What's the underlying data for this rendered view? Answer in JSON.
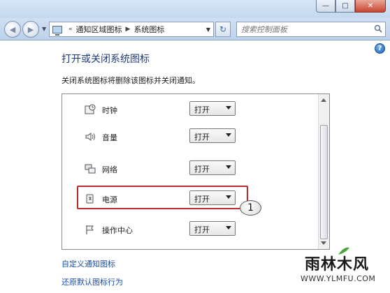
{
  "window": {
    "minimize_label": "—",
    "maximize_label": "□",
    "close_label": "✕"
  },
  "addressbar": {
    "crumbs": [
      "通知区域图标",
      "系统图标"
    ],
    "search_placeholder": "搜索控制面板"
  },
  "main": {
    "title": "打开或关闭系统图标",
    "description": "关闭系统图标将删除该图标并关闭通知。",
    "items": [
      {
        "name": "时钟",
        "value": "打开",
        "icon": "clock-icon"
      },
      {
        "name": "音量",
        "value": "打开",
        "icon": "volume-icon"
      },
      {
        "name": "网络",
        "value": "打开",
        "icon": "network-icon"
      },
      {
        "name": "电源",
        "value": "打开",
        "icon": "power-icon"
      },
      {
        "name": "操作中心",
        "value": "打开",
        "icon": "flag-icon"
      }
    ],
    "links": [
      "自定义通知图标",
      "还原默认图标行为"
    ]
  },
  "annotation": {
    "callout_number": "1",
    "highlight_color": "#b92a2a"
  },
  "watermark": {
    "main": "雨林木风",
    "sub": "WWW.YLMFU.COM"
  },
  "colors": {
    "title": "#1e3b78",
    "link": "#1a4fa8"
  }
}
